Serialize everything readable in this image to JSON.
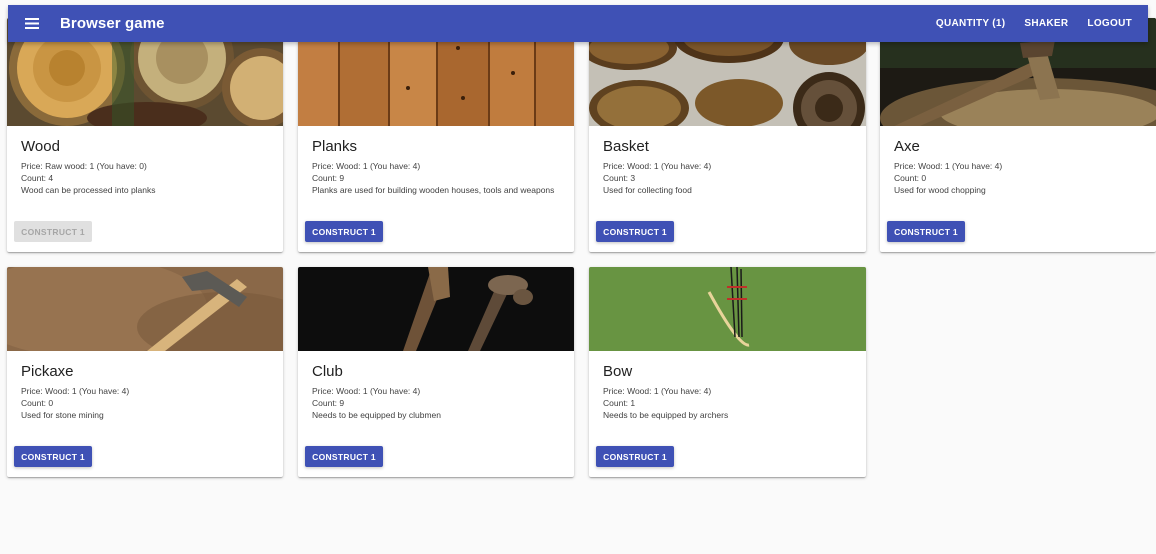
{
  "app": {
    "title": "Browser game",
    "menu_icon": "menu-icon"
  },
  "nav": {
    "quantity": "QUANTITY (1)",
    "shaker": "SHAKER",
    "logout": "LOGOUT"
  },
  "colors": {
    "primary": "#3f51b5",
    "disabled_bg": "#e0e0e0",
    "disabled_text": "#a6a6a6"
  },
  "cards": [
    {
      "title": "Wood",
      "price": "Price: Raw wood: 1 (You have: 0)",
      "count": "Count: 4",
      "description": "Wood can be processed into planks",
      "button": "CONSTRUCT 1",
      "enabled": false
    },
    {
      "title": "Planks",
      "price": "Price: Wood: 1 (You have: 4)",
      "count": "Count: 9",
      "description": "Planks are used for building wooden houses, tools and weapons",
      "button": "CONSTRUCT 1",
      "enabled": true
    },
    {
      "title": "Basket",
      "price": "Price: Wood: 1 (You have: 4)",
      "count": "Count: 3",
      "description": "Used for collecting food",
      "button": "CONSTRUCT 1",
      "enabled": true
    },
    {
      "title": "Axe",
      "price": "Price: Wood: 1 (You have: 4)",
      "count": "Count: 0",
      "description": "Used for wood chopping",
      "button": "CONSTRUCT 1",
      "enabled": true
    },
    {
      "title": "Pickaxe",
      "price": "Price: Wood: 1 (You have: 4)",
      "count": "Count: 0",
      "description": "Used for stone mining",
      "button": "CONSTRUCT 1",
      "enabled": true
    },
    {
      "title": "Club",
      "price": "Price: Wood: 1 (You have: 4)",
      "count": "Count: 9",
      "description": "Needs to be equipped by clubmen",
      "button": "CONSTRUCT 1",
      "enabled": true
    },
    {
      "title": "Bow",
      "price": "Price: Wood: 1 (You have: 4)",
      "count": "Count: 1",
      "description": "Needs to be equipped by archers",
      "button": "CONSTRUCT 1",
      "enabled": true
    }
  ]
}
